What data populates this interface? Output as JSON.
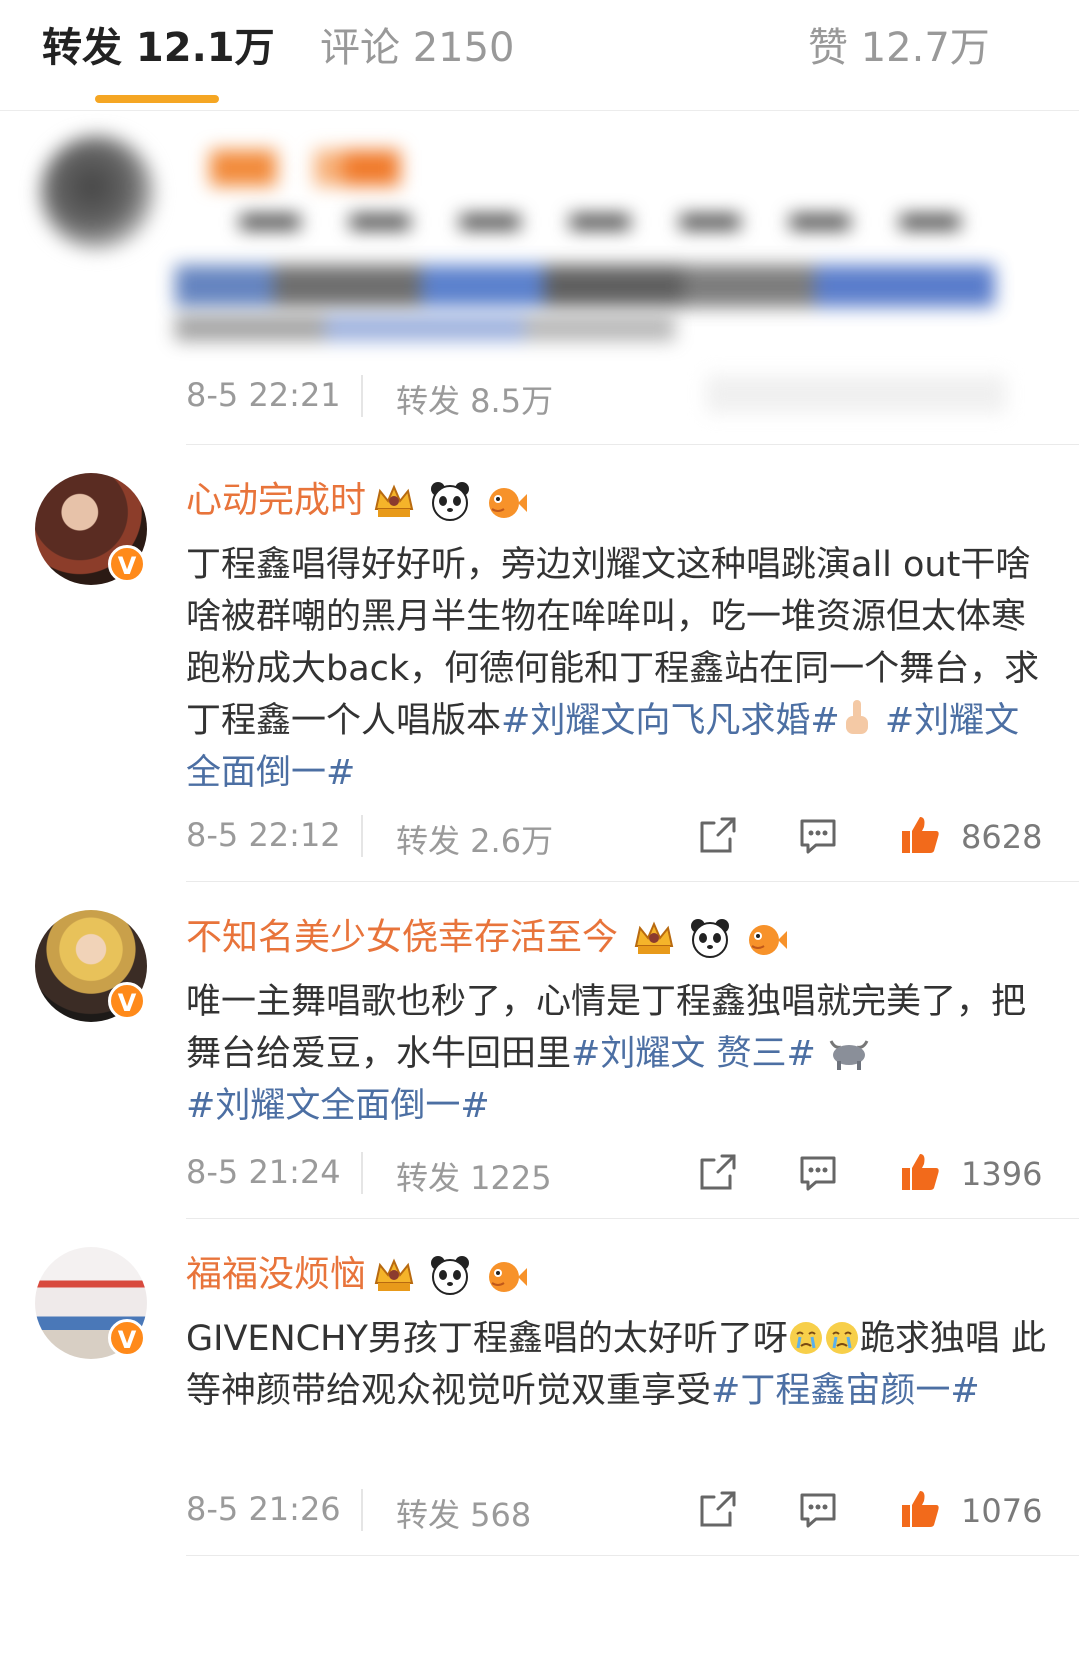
{
  "tabs": [
    {
      "label": "转发 12.1万"
    },
    {
      "label": "评论 2150"
    },
    {
      "label": "赞 12.7万"
    }
  ],
  "first_post": {
    "time": "8-5 22:21",
    "repost": "转发 8.5万"
  },
  "posts": [
    {
      "username": "心动完成时",
      "content_text": "丁程鑫唱得好好听，旁边刘耀文这种唱跳演all out干啥啥被群嘲的黑月半生物在哞哞叫，吃一堆资源但太体寒跑粉成大back，何德何能和丁程鑫站在同一个舞台，求丁程鑫一个人唱版本",
      "hashtag1": "#刘耀文向飞凡求婚#",
      "hashtag2": "#刘耀文全面倒一#",
      "time": "8-5 22:12",
      "repost": "转发 2.6万",
      "likes": "8628"
    },
    {
      "username": "不知名美少女侥幸存活至今",
      "content_text": "唯一主舞唱歌也秒了，心情是丁程鑫独唱就完美了，把舞台给爱豆，水牛回田里",
      "hashtag1": "#刘耀文 赘三#",
      "hashtag2": "#刘耀文全面倒一#",
      "time": "8-5 21:24",
      "repost": "转发 1225",
      "likes": "1396"
    },
    {
      "username": "福福没烦恼",
      "content_text_a": "GIVENCHY男孩丁程鑫唱的太好听了呀",
      "content_text_b": "跪求独唱 此等神颜带给观众视觉听觉双重享受",
      "hashtag1": "#丁程鑫宙颜一#",
      "time": "8-5 21:26",
      "repost": "转发 568",
      "likes": "1076"
    }
  ],
  "verified_mark": "V",
  "colors": {
    "accent": "#f5a623",
    "username": "#e8743b",
    "hashtag": "#4c6fa3",
    "like": "#f26a1b"
  },
  "icons": [
    "share-icon",
    "comment-icon",
    "thumbs-up-icon",
    "crown-icon",
    "panda-icon",
    "fish-icon",
    "middle-finger-icon",
    "ox-icon",
    "crying-icon"
  ]
}
